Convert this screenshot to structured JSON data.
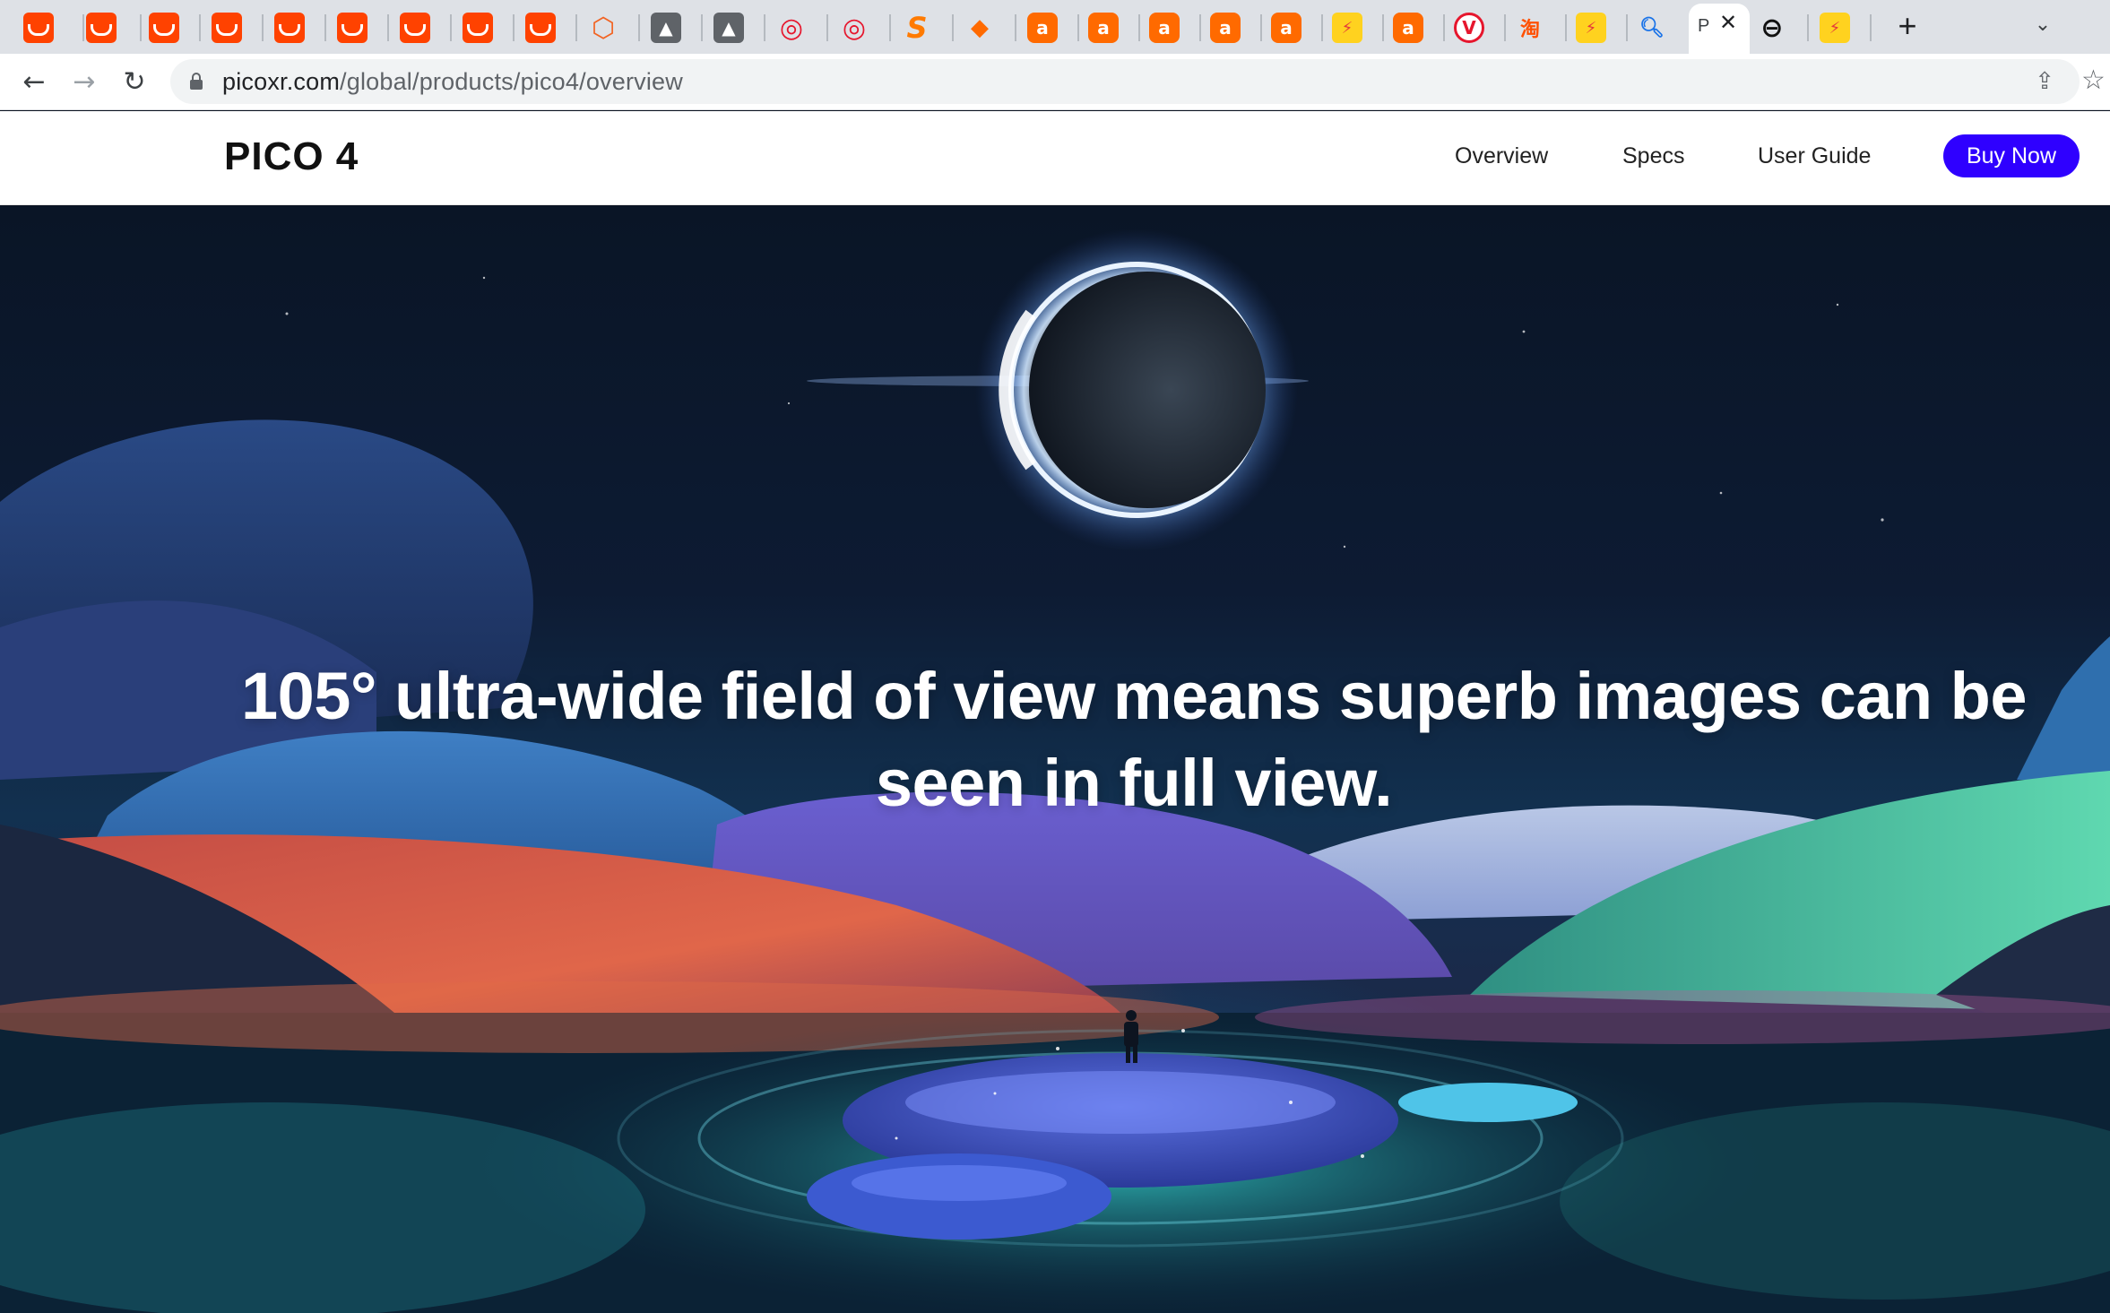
{
  "browser": {
    "active_tab": {
      "title": "P"
    },
    "url": {
      "host": "picoxr.com",
      "path": "/global/products/pico4/overview"
    },
    "tab_icons": [
      "tmall-icon",
      "tmall-icon",
      "tmall-icon",
      "tmall-icon",
      "tmall-icon",
      "tmall-icon",
      "tmall-icon",
      "tmall-icon",
      "tmall-icon",
      "magento-icon",
      "gray-app-icon",
      "gray-app-icon",
      "weibo-icon",
      "weibo-icon",
      "s-logo-icon",
      "diamond-icon",
      "alibaba-icon",
      "alibaba-icon",
      "alibaba-icon",
      "alibaba-icon",
      "alibaba-icon",
      "yellow-app-icon",
      "alibaba-icon",
      "v-logo-icon",
      "taobao-icon",
      "yellow-app-icon",
      "search-icon"
    ]
  },
  "site": {
    "logo": "PICO 4",
    "nav": {
      "overview": "Overview",
      "specs": "Specs",
      "user_guide": "User Guide",
      "buy_now": "Buy Now"
    },
    "accent_color": "#2f00ff"
  },
  "hero": {
    "headline": "105° ultra-wide field of view means superb images can be seen in full view."
  }
}
